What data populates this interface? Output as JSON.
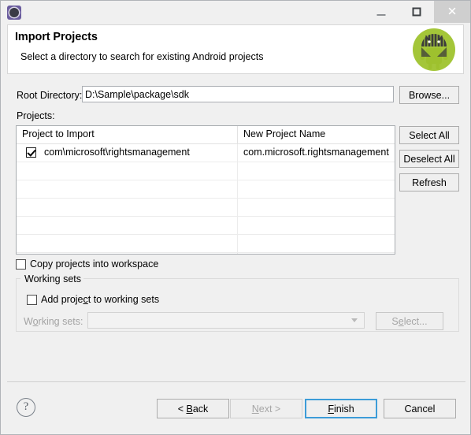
{
  "window": {
    "app_icon": "gear-icon",
    "controls": {
      "minimize": "minimize-icon",
      "maximize": "maximize-icon",
      "close": "✕"
    }
  },
  "header": {
    "title": "Import Projects",
    "subtitle": "Select a directory to search for existing Android projects",
    "logo": "android-robot-icon",
    "logo_colors": {
      "body": "#a4c639",
      "circle": "#a4c639",
      "dark": "#3c3c3c"
    }
  },
  "form": {
    "root_directory_label": "Root Directory:",
    "root_directory_value": "D:\\Sample\\package\\sdk",
    "root_directory_placeholder": "",
    "browse_label": "Browse...",
    "projects_label": "Projects:"
  },
  "table": {
    "columns": [
      "Project to Import",
      "New Project Name"
    ],
    "rows": [
      {
        "checked": true,
        "project_to_import": "com\\microsoft\\rightsmanagement",
        "new_project_name": "com.microsoft.rightsmanagement"
      },
      {
        "checked": null,
        "project_to_import": "",
        "new_project_name": ""
      },
      {
        "checked": null,
        "project_to_import": "",
        "new_project_name": ""
      },
      {
        "checked": null,
        "project_to_import": "",
        "new_project_name": ""
      },
      {
        "checked": null,
        "project_to_import": "",
        "new_project_name": ""
      },
      {
        "checked": null,
        "project_to_import": "",
        "new_project_name": ""
      },
      {
        "checked": null,
        "project_to_import": "",
        "new_project_name": ""
      }
    ]
  },
  "side_buttons": {
    "select_all": "Select All",
    "deselect_all": "Deselect All",
    "refresh": "Refresh"
  },
  "options": {
    "copy_projects_label": "Copy projects into workspace",
    "copy_projects_checked": false
  },
  "working_sets": {
    "group_label": "Working sets",
    "add_project_label_pre": "Add proje",
    "add_project_accel": "c",
    "add_project_label_post": "t to working sets",
    "add_project_checked": false,
    "combo_label_pre": "W",
    "combo_label_accel": "o",
    "combo_label_post": "rking sets:",
    "combo_value": "",
    "select_label_pre": "S",
    "select_label_accel": "e",
    "select_label_post": "lect...",
    "disabled": true
  },
  "footer": {
    "help": "?",
    "back_pre": "< ",
    "back_accel": "B",
    "back_post": "ack",
    "next_pre": "",
    "next_accel": "N",
    "next_post": "ext >",
    "next_disabled": true,
    "finish_pre": "",
    "finish_accel": "F",
    "finish_post": "inish",
    "finish_default": true,
    "cancel": "Cancel",
    "focus_color": "#3c9cd8"
  }
}
